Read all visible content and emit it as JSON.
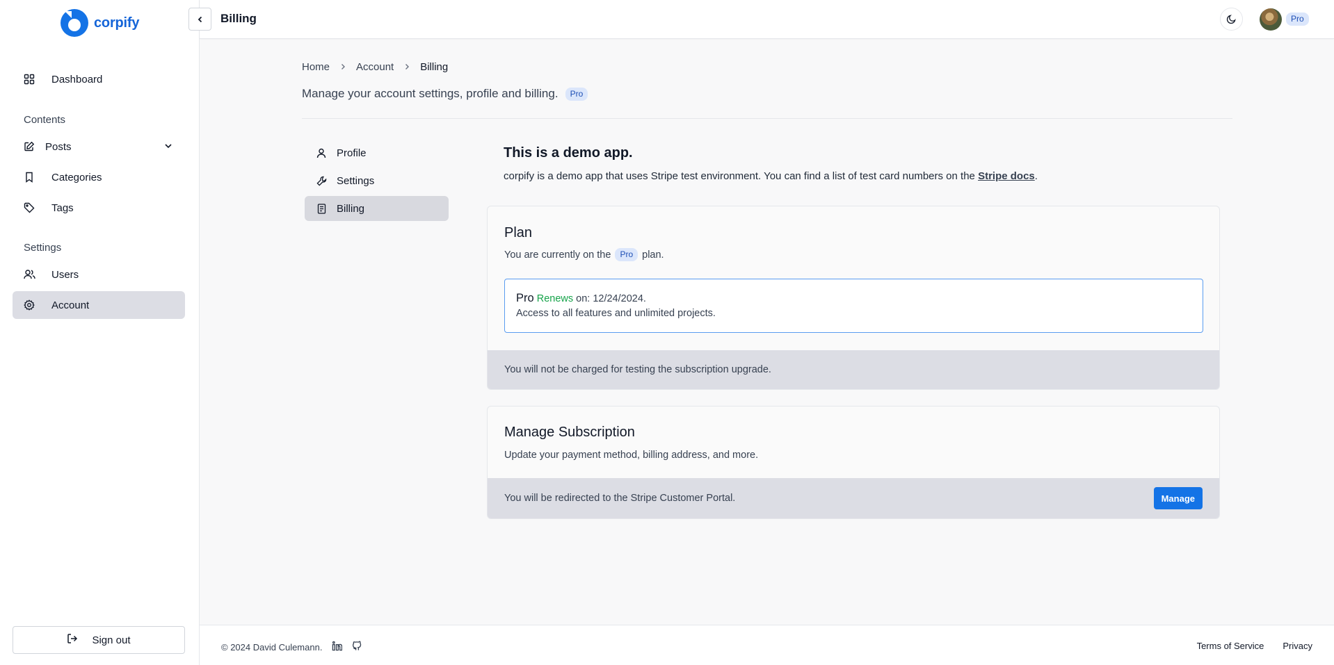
{
  "brand": {
    "name": "corpify",
    "color": "#1565d8"
  },
  "sidebar": {
    "dashboard": {
      "label": "Dashboard",
      "icon": "grid-icon"
    },
    "contents_title": "Contents",
    "posts": {
      "label": "Posts",
      "icon": "edit-icon"
    },
    "categories": {
      "label": "Categories",
      "icon": "bookmark-icon"
    },
    "tags": {
      "label": "Tags",
      "icon": "tag-icon"
    },
    "settings_title": "Settings",
    "users": {
      "label": "Users",
      "icon": "users-icon"
    },
    "account": {
      "label": "Account",
      "icon": "gear-icon",
      "active": true
    },
    "signout": "Sign out"
  },
  "topbar": {
    "title": "Billing",
    "badge": "Pro"
  },
  "breadcrumb": {
    "home": "Home",
    "account": "Account",
    "current": "Billing"
  },
  "subtitle": {
    "text": "Manage your account settings, profile and billing.",
    "badge": "Pro"
  },
  "subnav": {
    "profile": "Profile",
    "settings": "Settings",
    "billing": "Billing",
    "active": "Billing"
  },
  "demo": {
    "title": "This is a demo app.",
    "text": "corpify is a demo app that uses Stripe test environment. You can find a list of test card numbers on the",
    "link": "Stripe docs",
    "end": "."
  },
  "plan": {
    "title": "Plan",
    "desc_before": "You are currently on the",
    "badge": "Pro",
    "desc_after": "plan.",
    "box_name": "Pro",
    "box_renews": "Renews",
    "box_date": "on: 12/24/2024.",
    "box_text": "Access to all features and unlimited projects.",
    "footer": "You will not be charged for testing the subscription upgrade."
  },
  "subscription": {
    "title": "Manage Subscription",
    "desc": "Update your payment method, billing address, and more.",
    "footer": "You will be redirected to the Stripe Customer Portal.",
    "button": "Manage"
  },
  "footer": {
    "copyright": "© 2024 David Culemann.",
    "terms": "Terms of Service",
    "privacy": "Privacy"
  },
  "colors": {
    "accent": "#1473e6",
    "success": "#16a34a",
    "active_bg": "#dcdde4"
  }
}
